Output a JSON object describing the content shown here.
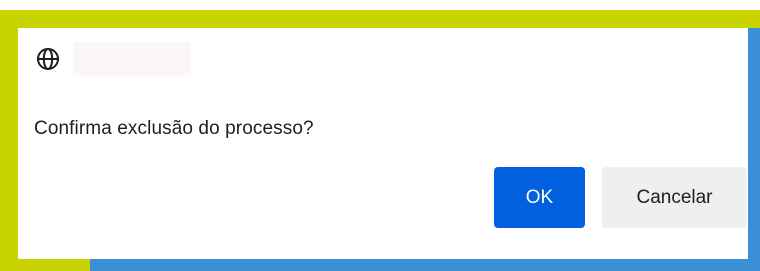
{
  "dialog": {
    "icon": "globe-icon",
    "origin_text": "",
    "message": "Confirma exclusão do processo?",
    "ok_label": "OK",
    "cancel_label": "Cancelar"
  },
  "colors": {
    "accent": "#0060df",
    "border_green": "#c8d400",
    "border_blue": "#3a8fd6",
    "cancel_bg": "#efefef"
  }
}
